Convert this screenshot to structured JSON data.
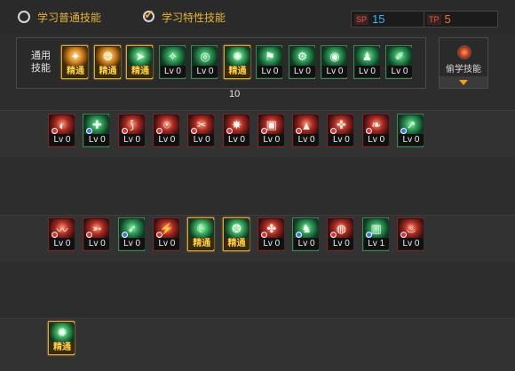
{
  "tabs": {
    "normal_label": "学习普通技能",
    "special_label": "学习特性技能"
  },
  "points": [
    {
      "tag": "SP",
      "value": "15",
      "color": "#3ab4ff"
    },
    {
      "tag": "TP",
      "value": "5",
      "color": "#ff6a3a"
    }
  ],
  "general": {
    "title": "通用\n技能",
    "count": "10"
  },
  "side_button": {
    "label": "偷学技能"
  },
  "level_labels": {
    "mastered": "精通"
  },
  "general_skills": [
    {
      "type": "gold orange",
      "glyph": "✦",
      "level": "精通"
    },
    {
      "type": "gold orange",
      "glyph": "❂",
      "level": "精通"
    },
    {
      "type": "gold green",
      "glyph": "➤",
      "level": "精通"
    },
    {
      "type": "green",
      "glyph": "✧",
      "level": "Lv 0"
    },
    {
      "type": "green",
      "glyph": "◎",
      "level": "Lv 0"
    },
    {
      "type": "gold green",
      "glyph": "✺",
      "level": "精通"
    },
    {
      "type": "green",
      "glyph": "⚑",
      "level": "Lv 0"
    },
    {
      "type": "green",
      "glyph": "⚙",
      "level": "Lv 0"
    },
    {
      "type": "green",
      "glyph": "◉",
      "level": "Lv 0"
    },
    {
      "type": "green",
      "glyph": "♟",
      "level": "Lv 0"
    },
    {
      "type": "green",
      "glyph": "✐",
      "level": "Lv 0"
    }
  ],
  "row1": [
    {
      "type": "red",
      "glyph": "◐",
      "mark": "red",
      "level": "Lv 0"
    },
    {
      "type": "green",
      "glyph": "✚",
      "mark": "blue",
      "level": "Lv 0"
    },
    {
      "type": "red",
      "glyph": "⟆",
      "mark": "red",
      "level": "Lv 0"
    },
    {
      "type": "red",
      "glyph": "⍟",
      "mark": "red",
      "level": "Lv 0"
    },
    {
      "type": "red",
      "glyph": "✂",
      "mark": "red",
      "level": "Lv 0"
    },
    {
      "type": "red",
      "glyph": "✸",
      "mark": "red",
      "level": "Lv 0"
    },
    {
      "type": "red",
      "glyph": "▣",
      "mark": "red",
      "level": "Lv 0"
    },
    {
      "type": "red",
      "glyph": "▲",
      "mark": "red",
      "level": "Lv 0"
    },
    {
      "type": "red",
      "glyph": "✜",
      "mark": "red",
      "level": "Lv 0"
    },
    {
      "type": "red",
      "glyph": "❧",
      "mark": "red",
      "level": "Lv 0"
    },
    {
      "type": "green",
      "glyph": "↗",
      "mark": "blue",
      "level": "Lv 0"
    }
  ],
  "row2": [
    {
      "type": "red",
      "glyph": "〰",
      "mark": "red",
      "level": "Lv 0"
    },
    {
      "type": "red",
      "glyph": "➳",
      "mark": "red",
      "level": "Lv 0"
    },
    {
      "type": "green",
      "glyph": "➶",
      "mark": "blue",
      "level": "Lv 0"
    },
    {
      "type": "red",
      "glyph": "⚡",
      "mark": "red",
      "level": "Lv 0"
    },
    {
      "type": "gold green",
      "glyph": "☾",
      "mark": "",
      "level": "精通"
    },
    {
      "type": "gold green",
      "glyph": "✪",
      "mark": "",
      "level": "精通"
    },
    {
      "type": "red",
      "glyph": "✤",
      "mark": "red",
      "level": "Lv 0"
    },
    {
      "type": "green",
      "glyph": "♞",
      "mark": "blue",
      "level": "Lv 0"
    },
    {
      "type": "red",
      "glyph": "◍",
      "mark": "red",
      "level": "Lv 0"
    },
    {
      "type": "green",
      "glyph": "▥",
      "mark": "blue",
      "level": "Lv 1"
    },
    {
      "type": "red",
      "glyph": "♨",
      "mark": "red",
      "level": "Lv 0"
    }
  ],
  "row3": [
    {
      "type": "gold green",
      "glyph": "✺",
      "mark": "",
      "level": "精通"
    }
  ]
}
